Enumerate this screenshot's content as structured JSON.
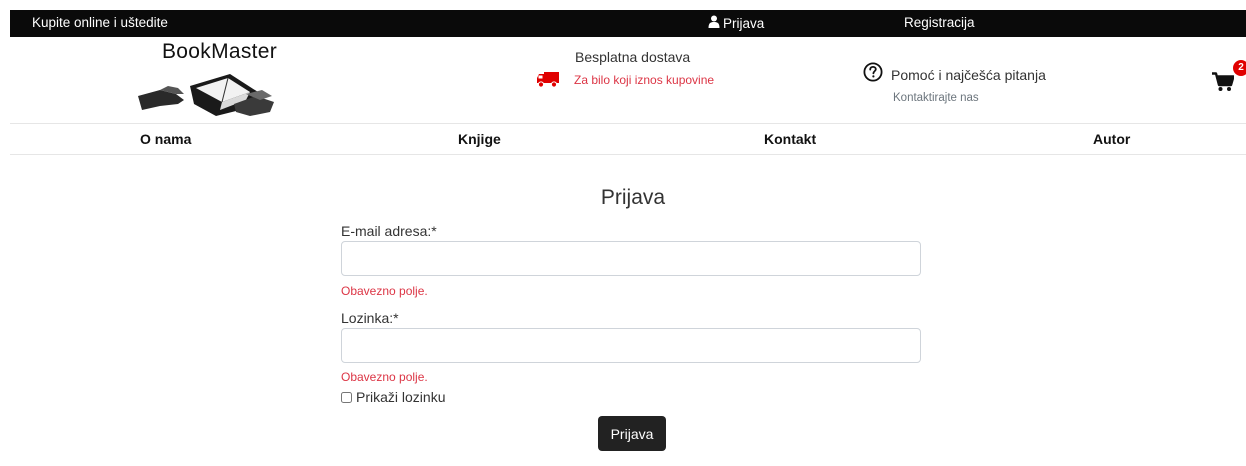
{
  "topbar": {
    "promo": "Kupite online i uštedite",
    "login_label": "Prijava",
    "register_label": "Registracija"
  },
  "header": {
    "brand_name": "BookMaster",
    "shipping_title": "Besplatna dostava",
    "shipping_subtitle": "Za bilo koji iznos kupovine",
    "help_title": "Pomoć i najčešća pitanja",
    "help_subtitle": "Kontaktirajte nas",
    "cart_count": "2"
  },
  "nav": {
    "items": [
      "O nama",
      "Knjige",
      "Kontakt",
      "Autor"
    ]
  },
  "form": {
    "title": "Prijava",
    "email_label": "E-mail adresa:*",
    "email_value": "",
    "email_error": "Obavezno polje.",
    "password_label": "Lozinka:*",
    "password_value": "",
    "password_error": "Obavezno polje.",
    "show_password_label": "Prikaži lozinku",
    "show_password_checked": false,
    "submit_label": "Prijava"
  },
  "colors": {
    "topbar_bg": "#0a0a0a",
    "error": "#dc3545",
    "truck": "#e00000",
    "badge": "#e00000",
    "button_bg": "#222222"
  },
  "icons": {
    "login": "user-icon",
    "shipping": "truck-icon",
    "help": "question-circle-icon",
    "cart": "shopping-cart-icon"
  }
}
